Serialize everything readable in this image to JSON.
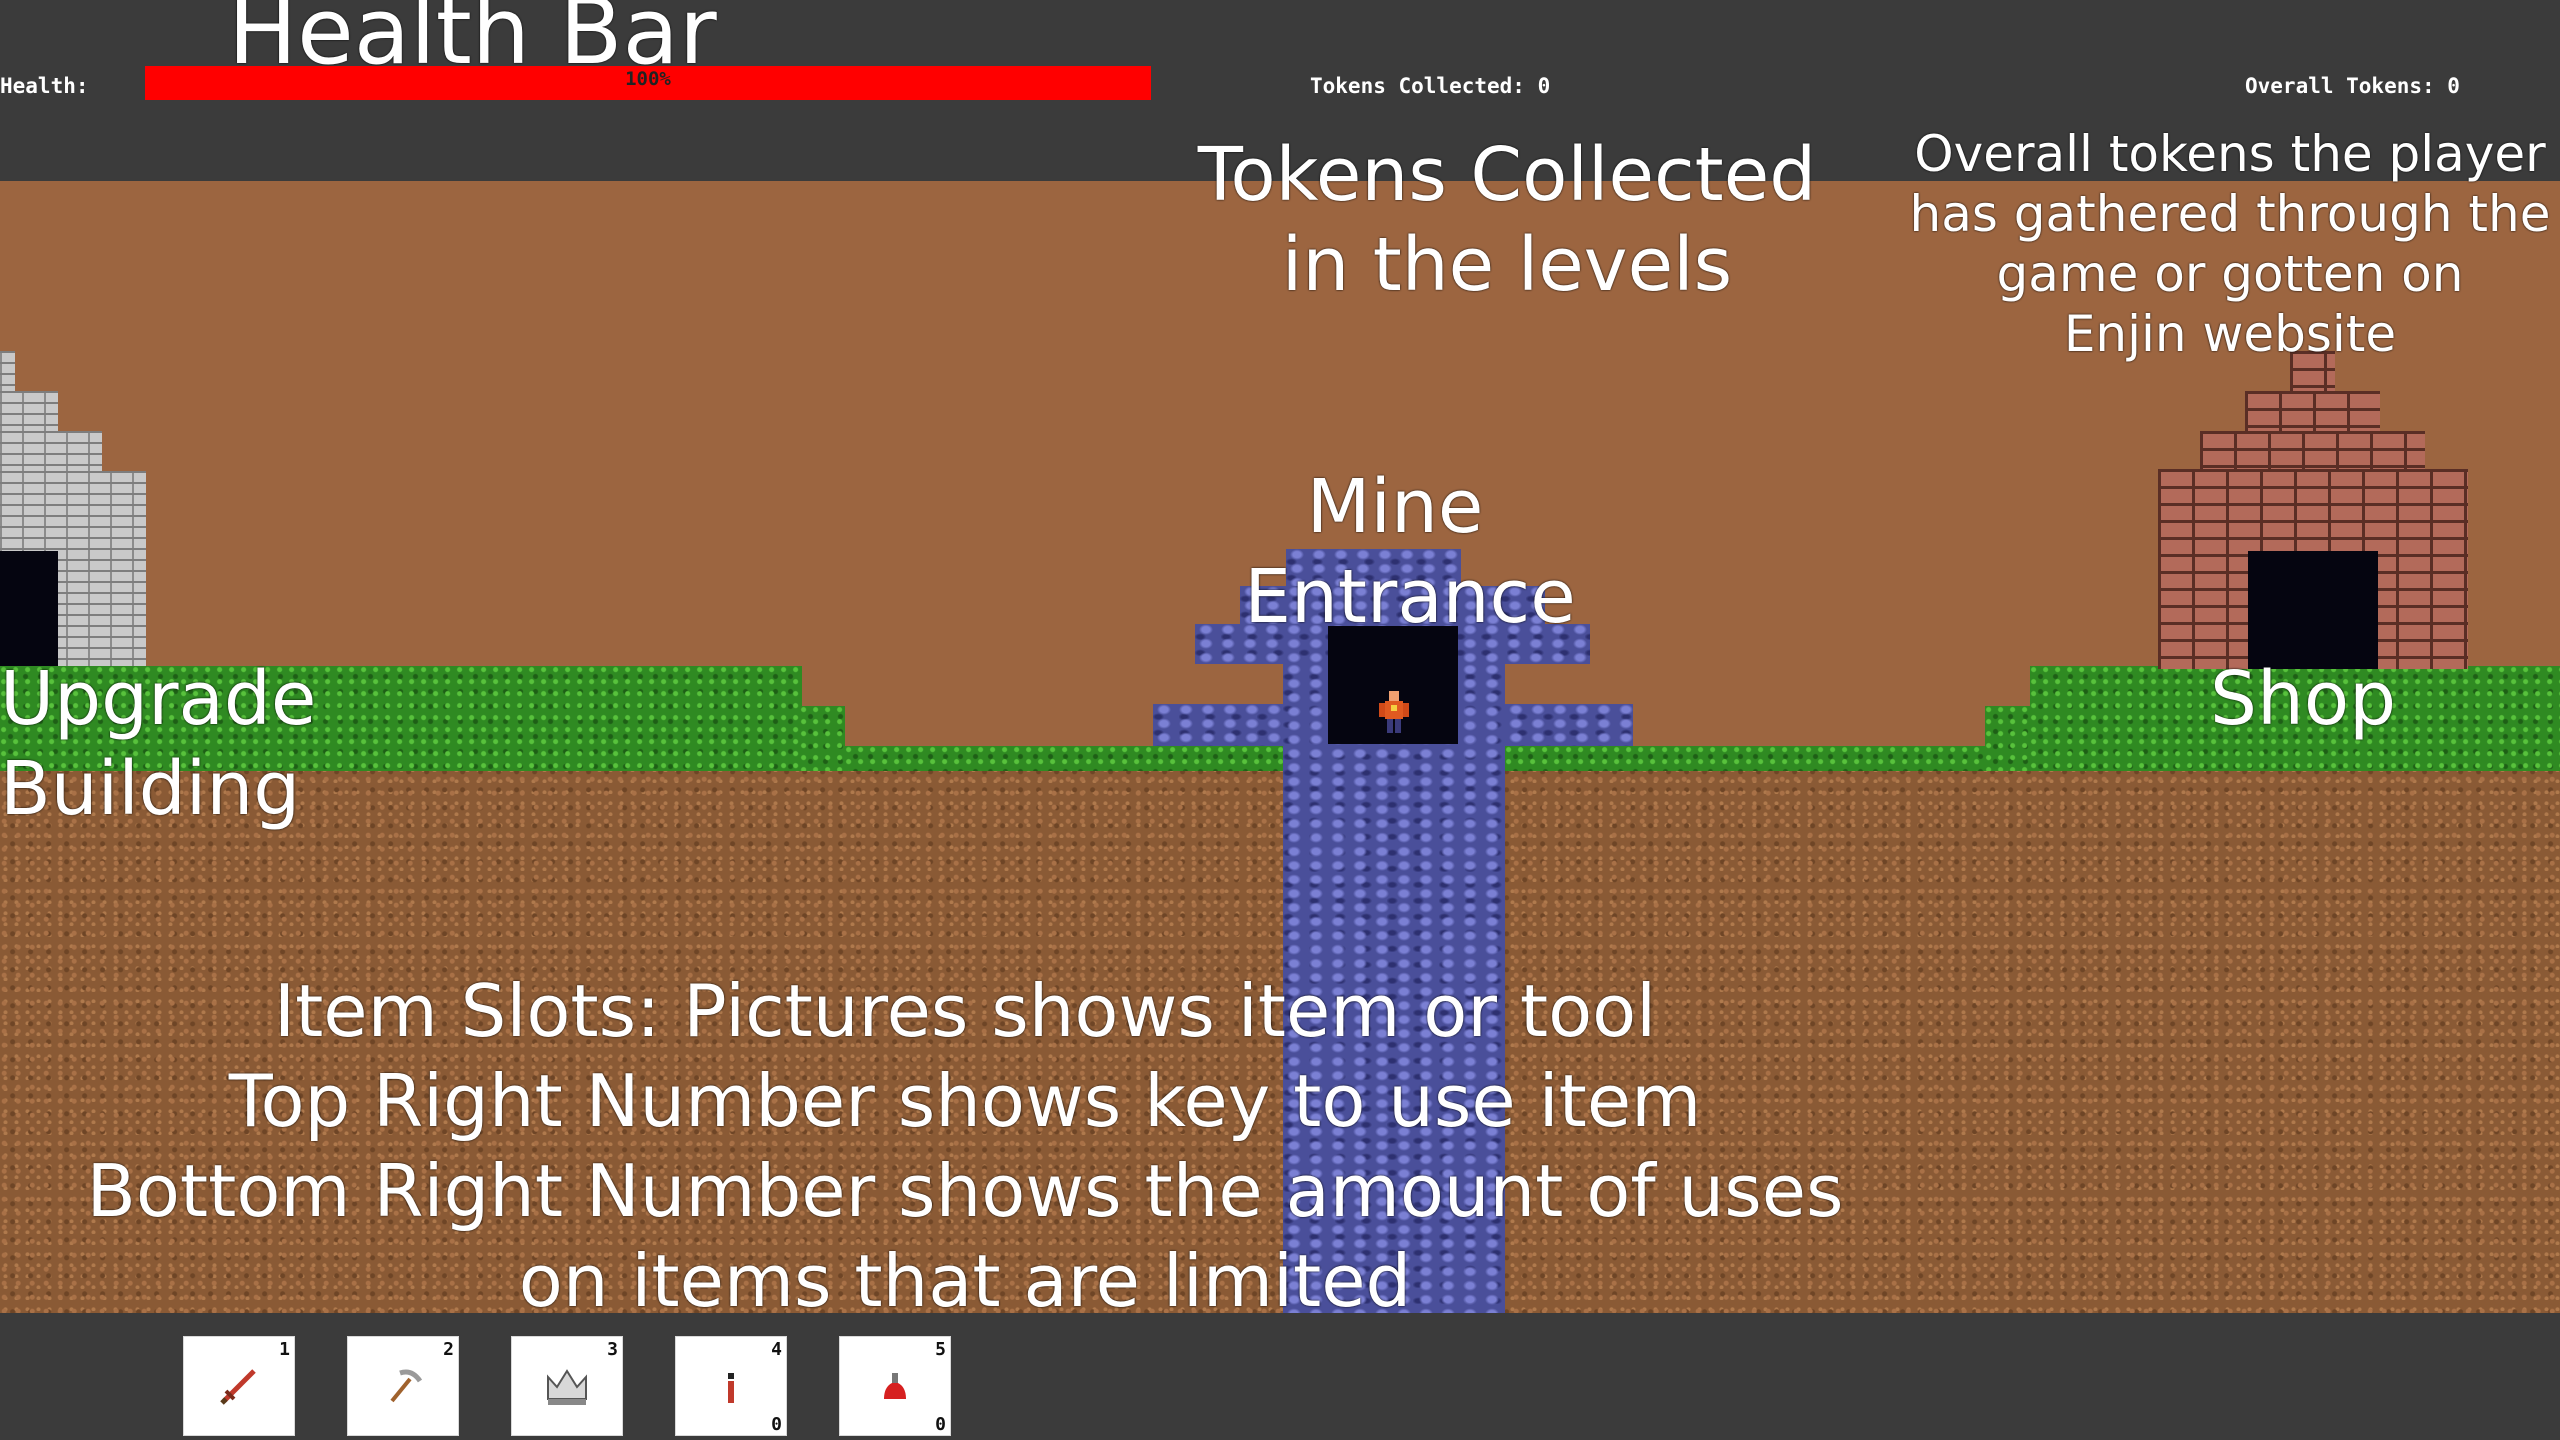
{
  "hud": {
    "health_label": "Health:",
    "health_percent": "100%",
    "health_value": 1.0,
    "tokens_collected": "Tokens Collected: 0",
    "overall_tokens": "Overall Tokens: 0"
  },
  "annotations": {
    "health_bar": "Health Bar",
    "tokens_collected_line1": "Tokens Collected",
    "tokens_collected_line2": "in the levels",
    "overall_line1": "Overall tokens the player",
    "overall_line2": "has gathered through the",
    "overall_line3": "game or gotten on",
    "overall_line4": "Enjin website",
    "mine_line1": "Mine",
    "mine_line2": "Entrance",
    "upgrade_line1": "Upgrade",
    "upgrade_line2": "Building",
    "shop": "Shop",
    "slots_line1": "Item Slots: Pictures shows item or tool",
    "slots_line2": "Top Right Number shows key to use item",
    "slots_line3": "Bottom Right Number shows the amount of uses",
    "slots_line4": "on items that are limited"
  },
  "item_slots": [
    {
      "key": "1",
      "uses": "",
      "icon": "sword-icon"
    },
    {
      "key": "2",
      "uses": "",
      "icon": "pickaxe-icon"
    },
    {
      "key": "3",
      "uses": "",
      "icon": "crown-icon"
    },
    {
      "key": "4",
      "uses": "0",
      "icon": "torch-icon"
    },
    {
      "key": "5",
      "uses": "0",
      "icon": "potion-icon"
    }
  ],
  "colors": {
    "health": "#ff0000",
    "hud_background": "#3b3b3b",
    "sky": "#9c6540"
  }
}
